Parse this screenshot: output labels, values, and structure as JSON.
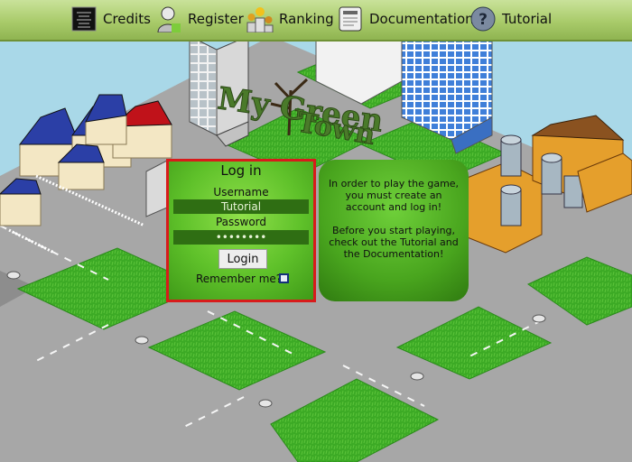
{
  "menu": [
    {
      "label": "Credits",
      "icon": "credits-icon"
    },
    {
      "label": "Register",
      "icon": "register-icon"
    },
    {
      "label": "Ranking",
      "icon": "ranking-icon"
    },
    {
      "label": "Documentation",
      "icon": "documentation-icon"
    },
    {
      "label": "Tutorial",
      "icon": "tutorial-icon"
    }
  ],
  "logo": {
    "text_line1": "My Green",
    "text_line2": "Town"
  },
  "login": {
    "title": "Log in",
    "username_label": "Username",
    "username_value": "Tutorial",
    "password_label": "Password",
    "password_value": "••••••••",
    "button_label": "Login",
    "remember_label": "Remember me?"
  },
  "info": {
    "paragraph1": "In order to play the game, you must create an account and log in!",
    "paragraph2": "Before you start playing, check out the Tutorial and the Documentation!"
  },
  "colors": {
    "accent_border": "#d81b1b",
    "panel_green": "#5fc12a",
    "grass": "#3fae2a",
    "road": "#9a9a9a",
    "sky": "#a9d8e8"
  }
}
